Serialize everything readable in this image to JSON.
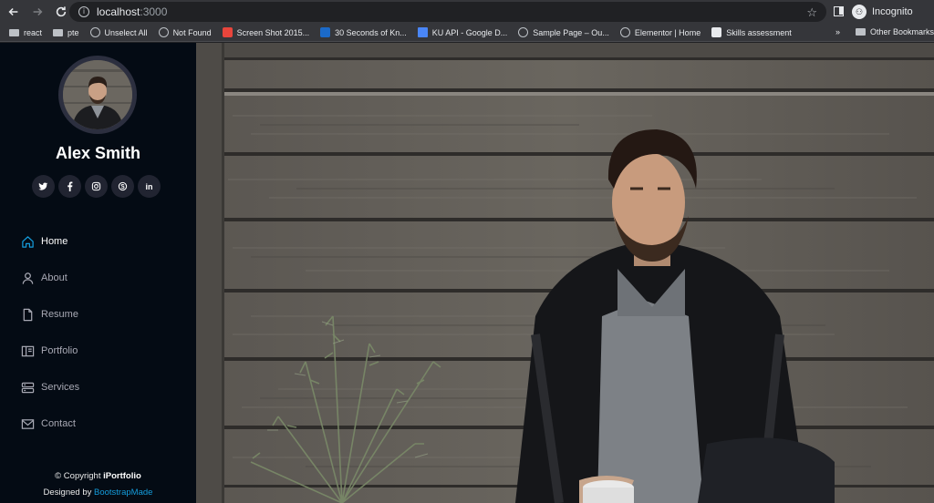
{
  "browser": {
    "url_host": "localhost",
    "url_port": ":3000",
    "incognito_label": "Incognito",
    "bookmarks": [
      {
        "label": "react",
        "icon": "folder-icon"
      },
      {
        "label": "pte",
        "icon": "folder-icon"
      },
      {
        "label": "Unselect All",
        "icon": "globe-icon"
      },
      {
        "label": "Not Found",
        "icon": "globe-icon"
      },
      {
        "label": "Screen Shot 2015...",
        "icon": "image-icon"
      },
      {
        "label": "30 Seconds of Kn...",
        "icon": "linkedin-icon"
      },
      {
        "label": "KU API - Google D...",
        "icon": "doc-icon"
      },
      {
        "label": "Sample Page – Ou...",
        "icon": "globe-icon"
      },
      {
        "label": "Elementor | Home",
        "icon": "globe-icon"
      },
      {
        "label": "Skills assessment",
        "icon": "site-icon"
      }
    ],
    "more_label": "»",
    "other_bookmarks": "Other Bookmarks"
  },
  "profile": {
    "name": "Alex Smith"
  },
  "socials": [
    {
      "name": "twitter"
    },
    {
      "name": "facebook"
    },
    {
      "name": "instagram"
    },
    {
      "name": "skype"
    },
    {
      "name": "linkedin",
      "text": "in"
    }
  ],
  "nav": [
    {
      "label": "Home",
      "icon": "home-icon",
      "active": true
    },
    {
      "label": "About",
      "icon": "person-icon",
      "active": false
    },
    {
      "label": "Resume",
      "icon": "file-icon",
      "active": false
    },
    {
      "label": "Portfolio",
      "icon": "book-icon",
      "active": false
    },
    {
      "label": "Services",
      "icon": "server-icon",
      "active": false
    },
    {
      "label": "Contact",
      "icon": "envelope-icon",
      "active": false
    }
  ],
  "footer": {
    "copyright_prefix": "© Copyright ",
    "brand": "iPortfolio",
    "designed_by": "Designed by ",
    "designer": "BootstrapMade"
  },
  "colors": {
    "sidebar_bg": "#040b14",
    "accent": "#149ddd",
    "social_bg": "#212431"
  }
}
